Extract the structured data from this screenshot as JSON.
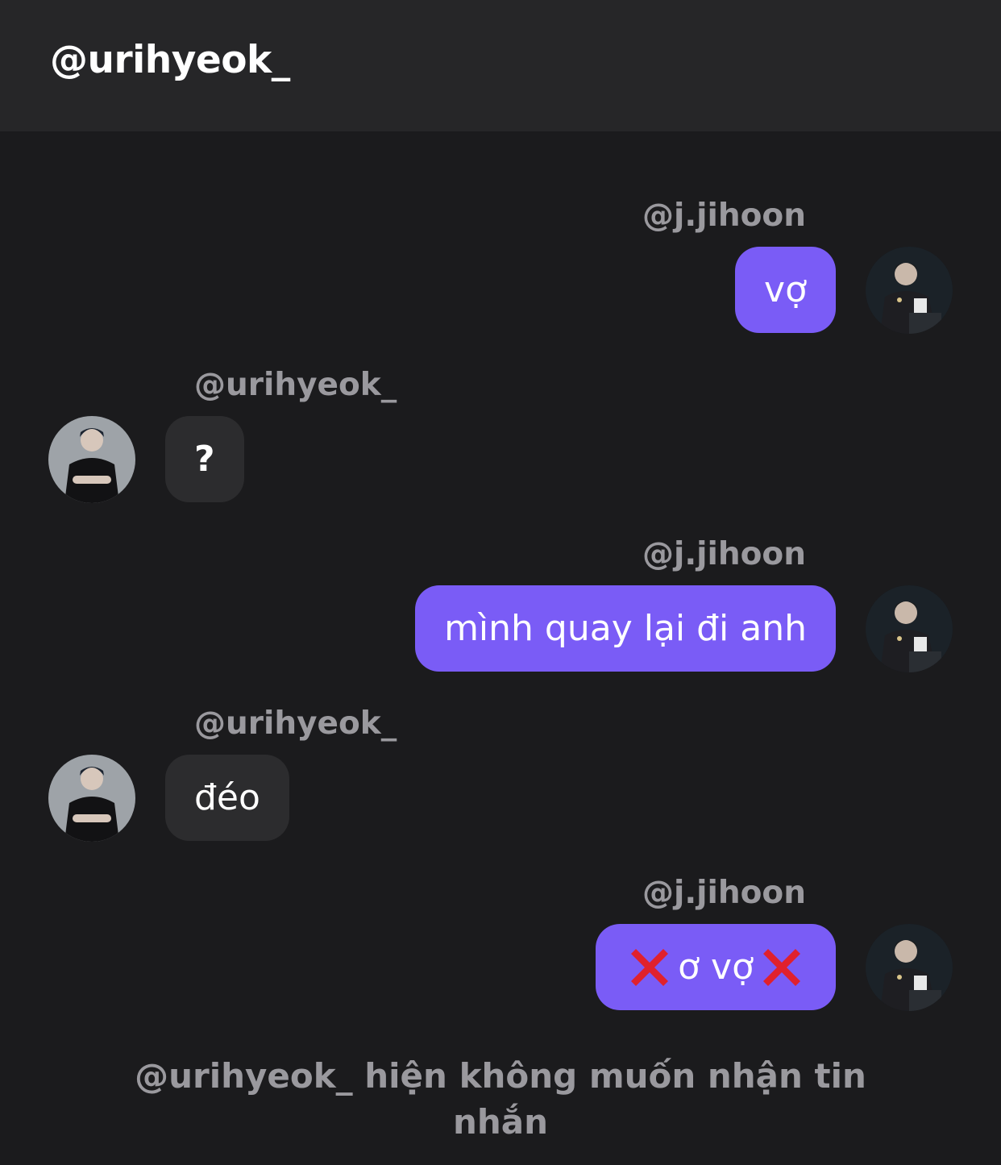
{
  "header": {
    "title": "@urihyeok_"
  },
  "messages": [
    {
      "sender": "@j.jihoon",
      "text": "vợ",
      "direction": "outgoing"
    },
    {
      "sender": "@urihyeok_",
      "text": "?",
      "direction": "incoming"
    },
    {
      "sender": "@j.jihoon",
      "text": "mình quay lại đi anh",
      "direction": "outgoing"
    },
    {
      "sender": "@urihyeok_",
      "text": "đéo",
      "direction": "incoming"
    },
    {
      "sender": "@j.jihoon",
      "text": "ơ vợ",
      "direction": "outgoing",
      "icon": "cross-mark-emoji"
    }
  ],
  "notice": {
    "text": "@urihyeok_ hiện không muốn nhận tin nhắn"
  },
  "colors": {
    "background": "#1b1b1d",
    "header": "#262628",
    "outgoing_bubble": "#7a5cf6",
    "incoming_bubble": "#2c2c2e",
    "muted_text": "#9a999e",
    "cross_mark": "#e0212d"
  }
}
